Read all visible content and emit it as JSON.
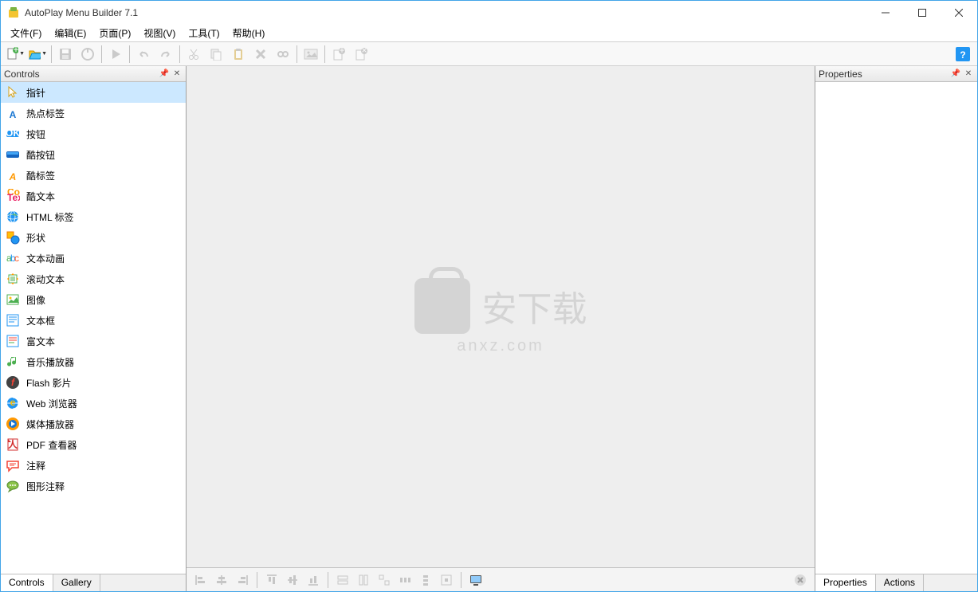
{
  "titlebar": {
    "title": "AutoPlay Menu Builder 7.1"
  },
  "menubar": {
    "items": [
      "文件(F)",
      "编辑(E)",
      "页面(P)",
      "视图(V)",
      "工具(T)",
      "帮助(H)"
    ]
  },
  "left_panel": {
    "title": "Controls",
    "tabs": [
      "Controls",
      "Gallery"
    ],
    "active_tab": 0,
    "items": [
      {
        "label": "指针",
        "icon": "pointer",
        "selected": true
      },
      {
        "label": "热点标签",
        "icon": "letter-a"
      },
      {
        "label": "按钮",
        "icon": "ok-button"
      },
      {
        "label": "酷按钮",
        "icon": "cool-button"
      },
      {
        "label": "酷标签",
        "icon": "cool-label"
      },
      {
        "label": "酷文本",
        "icon": "cool-text"
      },
      {
        "label": "HTML 标签",
        "icon": "globe"
      },
      {
        "label": "形状",
        "icon": "shapes"
      },
      {
        "label": "文本动画",
        "icon": "abc"
      },
      {
        "label": "滚动文本",
        "icon": "scroll-text"
      },
      {
        "label": "图像",
        "icon": "image"
      },
      {
        "label": "文本框",
        "icon": "textbox"
      },
      {
        "label": "富文本",
        "icon": "richtext"
      },
      {
        "label": "音乐播放器",
        "icon": "music"
      },
      {
        "label": "Flash 影片",
        "icon": "flash"
      },
      {
        "label": "Web 浏览器",
        "icon": "browser"
      },
      {
        "label": "媒体播放器",
        "icon": "media"
      },
      {
        "label": "PDF 查看器",
        "icon": "pdf"
      },
      {
        "label": "注释",
        "icon": "comment"
      },
      {
        "label": "图形注释",
        "icon": "graphic-comment"
      }
    ]
  },
  "right_panel": {
    "title": "Properties",
    "tabs": [
      "Properties",
      "Actions"
    ],
    "active_tab": 0
  },
  "watermark": {
    "text": "安下载",
    "sub": "anxz.com"
  }
}
